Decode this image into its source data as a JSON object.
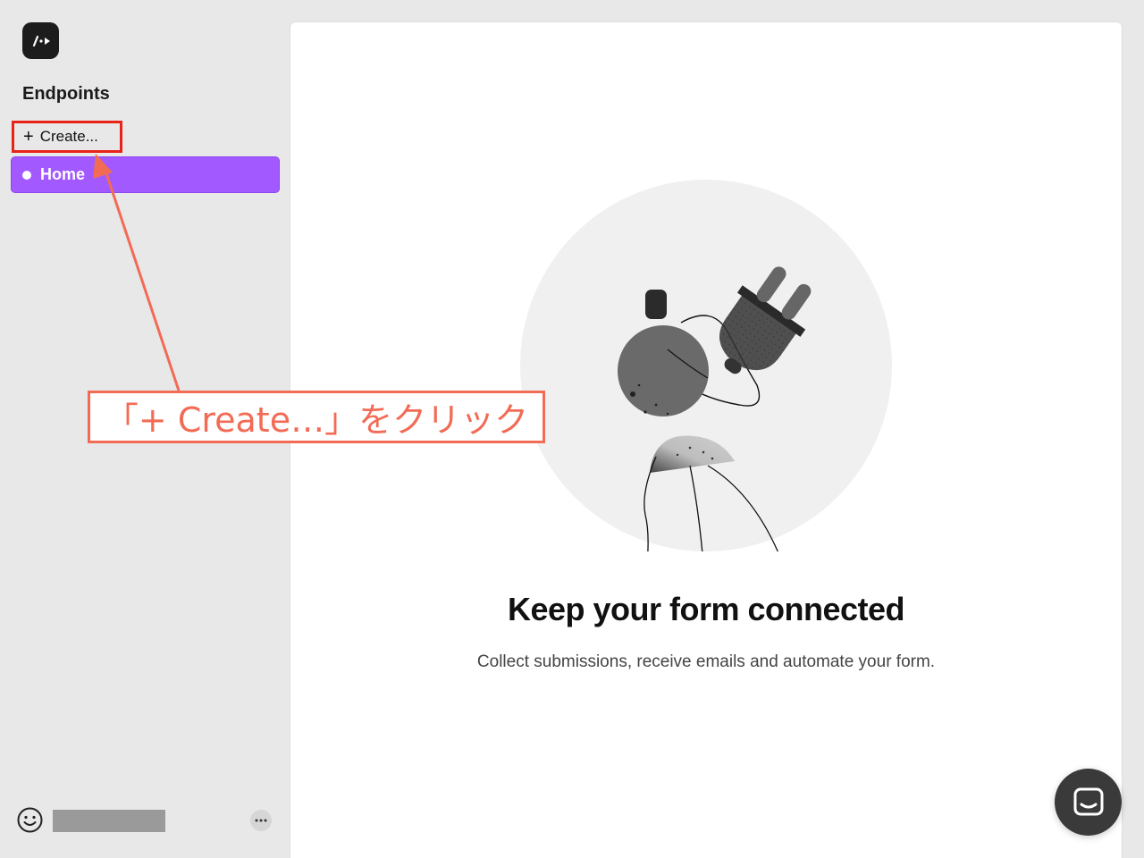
{
  "sidebar": {
    "section_title": "Endpoints",
    "create_label": "Create...",
    "items": [
      {
        "label": "Home",
        "active": true
      }
    ],
    "icons": {
      "logo": "app-logo-icon",
      "plus": "plus-icon",
      "user": "smiley-icon",
      "more": "ellipsis-icon"
    }
  },
  "main": {
    "empty_state": {
      "title": "Keep your form connected",
      "description": "Collect submissions, receive emails and automate your form."
    }
  },
  "chat": {
    "icon": "chat-icon"
  },
  "annotation": {
    "text": "「+ Create…」をクリック",
    "color": "#f26b55"
  },
  "colors": {
    "accent": "#a259ff",
    "highlight_border": "#e8231a",
    "background": "#e8e8e8",
    "panel": "#ffffff"
  }
}
